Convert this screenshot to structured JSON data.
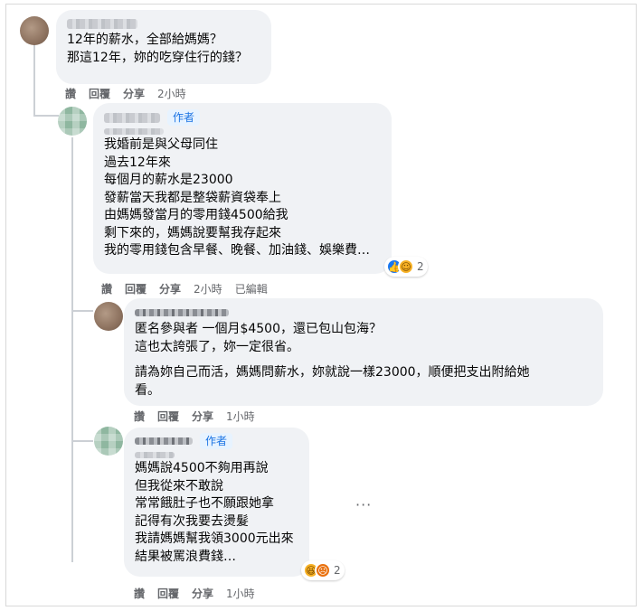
{
  "comments": [
    {
      "lines": [
        "12年的薪水，全部給媽媽？",
        "那這12年，妳的吃穿住行的錢？"
      ],
      "actions": {
        "like": "讚",
        "reply": "回覆",
        "share": "分享",
        "time": "2小時"
      }
    },
    {
      "badge": "作者",
      "lines": [
        "我婚前是與父母同住",
        "過去12年來",
        "每個月的薪水是23000",
        "發薪當天我都是整袋薪資袋奉上",
        "由媽媽發當月的零用錢4500給我",
        "剩下來的，媽媽說要幫我存起來",
        "我的零用錢包含早餐、晚餐、加油錢、娛樂費…"
      ],
      "reactions": {
        "icons": [
          "like-icon",
          "care-icon"
        ],
        "count": "2"
      },
      "actions": {
        "like": "讚",
        "reply": "回覆",
        "share": "分享",
        "time": "2小時",
        "edited": "已編輯"
      }
    },
    {
      "lines": [
        "匿名參與者 一個月$4500，還已包山包海？",
        "這也太誇張了，妳一定很省。"
      ],
      "lines2": [
        "請為妳自己而活，媽媽問薪水，妳就說一樣23000，順便把支出附給她",
        "看。"
      ],
      "actions": {
        "like": "讚",
        "reply": "回覆",
        "share": "分享",
        "time": "1小時"
      }
    },
    {
      "badge": "作者",
      "lines": [
        "媽媽說4500不夠用再說",
        "但我從來不敢說",
        "常常餓肚子也不願跟她拿",
        "記得有次我要去燙髮",
        "我請媽媽幫我領3000元出來",
        "結果被罵浪費錢…"
      ],
      "reactions": {
        "icons": [
          "haha-icon",
          "angry-icon"
        ],
        "count": "2"
      },
      "actions": {
        "like": "讚",
        "reply": "回覆",
        "share": "分享",
        "time": "1小時"
      }
    }
  ],
  "colors": {
    "bubble": "#f0f2f5",
    "meta": "#65676b",
    "badge": "#1b74e4",
    "thread": "#ccd0d5"
  }
}
